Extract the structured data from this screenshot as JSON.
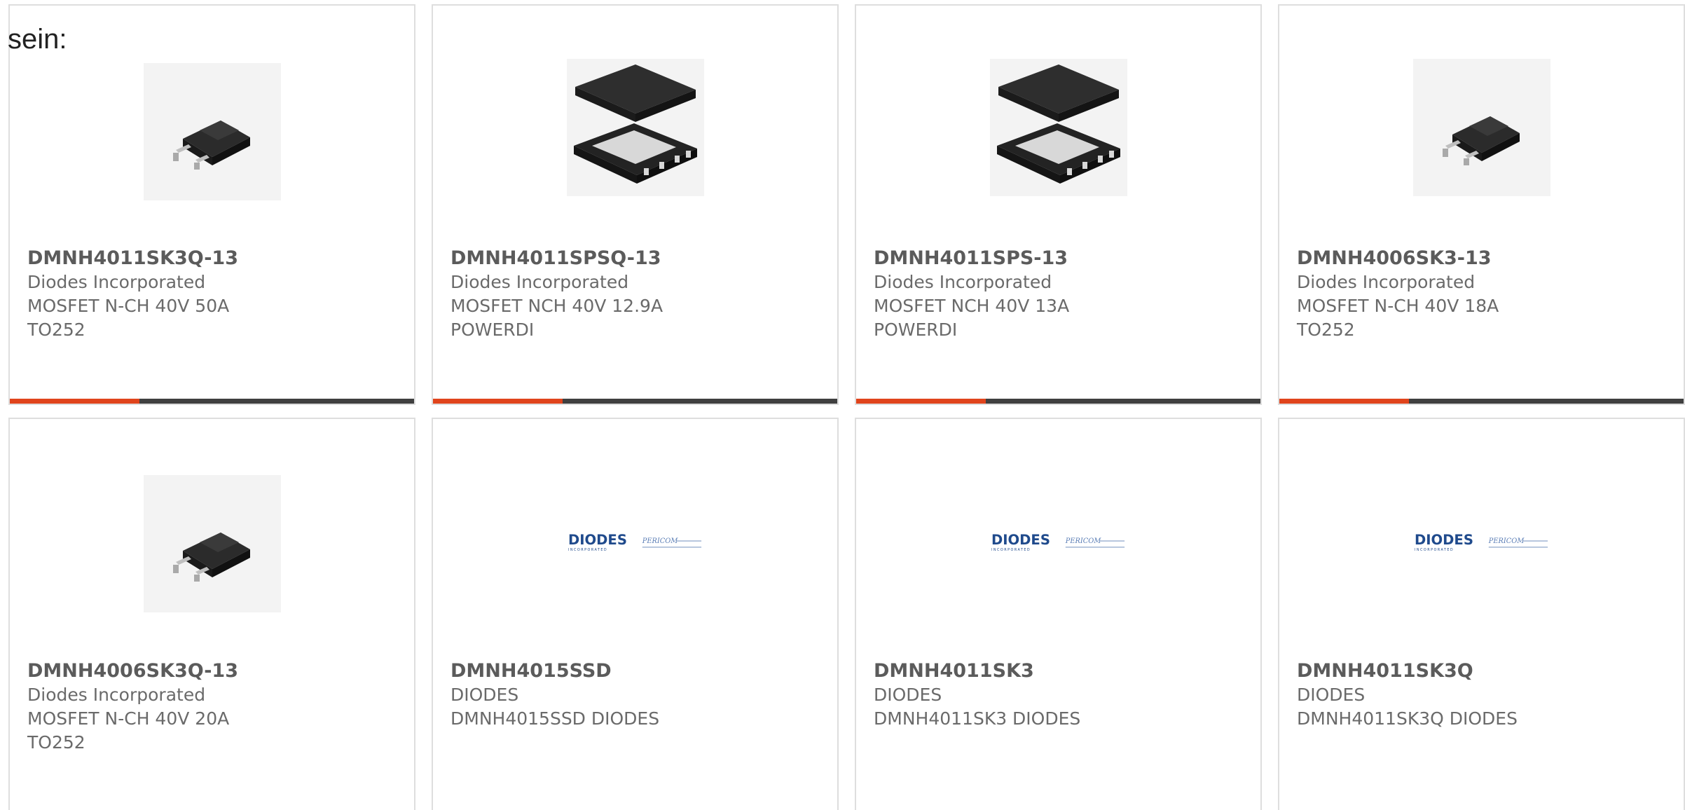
{
  "intro_text": "sein:",
  "accent_color": "#e0441c",
  "bar_color": "#404040",
  "products": [
    {
      "part": "DMNH4011SK3Q-13",
      "manufacturer": "Diodes Incorporated",
      "description": "MOSFET N-CH 40V 50A TO252",
      "image": "dpak-transistor-icon"
    },
    {
      "part": "DMNH4011SPSQ-13",
      "manufacturer": "Diodes Incorporated",
      "description": "MOSFET NCH 40V 12.9A POWERDI",
      "image": "powerdi-package-icon"
    },
    {
      "part": "DMNH4011SPS-13",
      "manufacturer": "Diodes Incorporated",
      "description": "MOSFET NCH 40V 13A POWERDI",
      "image": "powerdi-package-icon"
    },
    {
      "part": "DMNH4006SK3-13",
      "manufacturer": "Diodes Incorporated",
      "description": "MOSFET N-CH 40V 18A TO252",
      "image": "dpak-transistor-icon"
    },
    {
      "part": "DMNH4006SK3Q-13",
      "manufacturer": "Diodes Incorporated",
      "description": "MOSFET N-CH 40V 20A TO252",
      "image": "dpak-transistor-icon"
    },
    {
      "part": "DMNH4015SSD",
      "manufacturer": "DIODES",
      "description": "DMNH4015SSD DIODES",
      "image": "diodes-pericom-logo"
    },
    {
      "part": "DMNH4011SK3",
      "manufacturer": "DIODES",
      "description": "DMNH4011SK3 DIODES",
      "image": "diodes-pericom-logo"
    },
    {
      "part": "DMNH4011SK3Q",
      "manufacturer": "DIODES",
      "description": "DMNH4011SK3Q DIODES",
      "image": "diodes-pericom-logo"
    }
  ],
  "logo": {
    "brand": "DIODES",
    "brand_sub": "INCORPORATED",
    "partner": "PERICOM"
  }
}
